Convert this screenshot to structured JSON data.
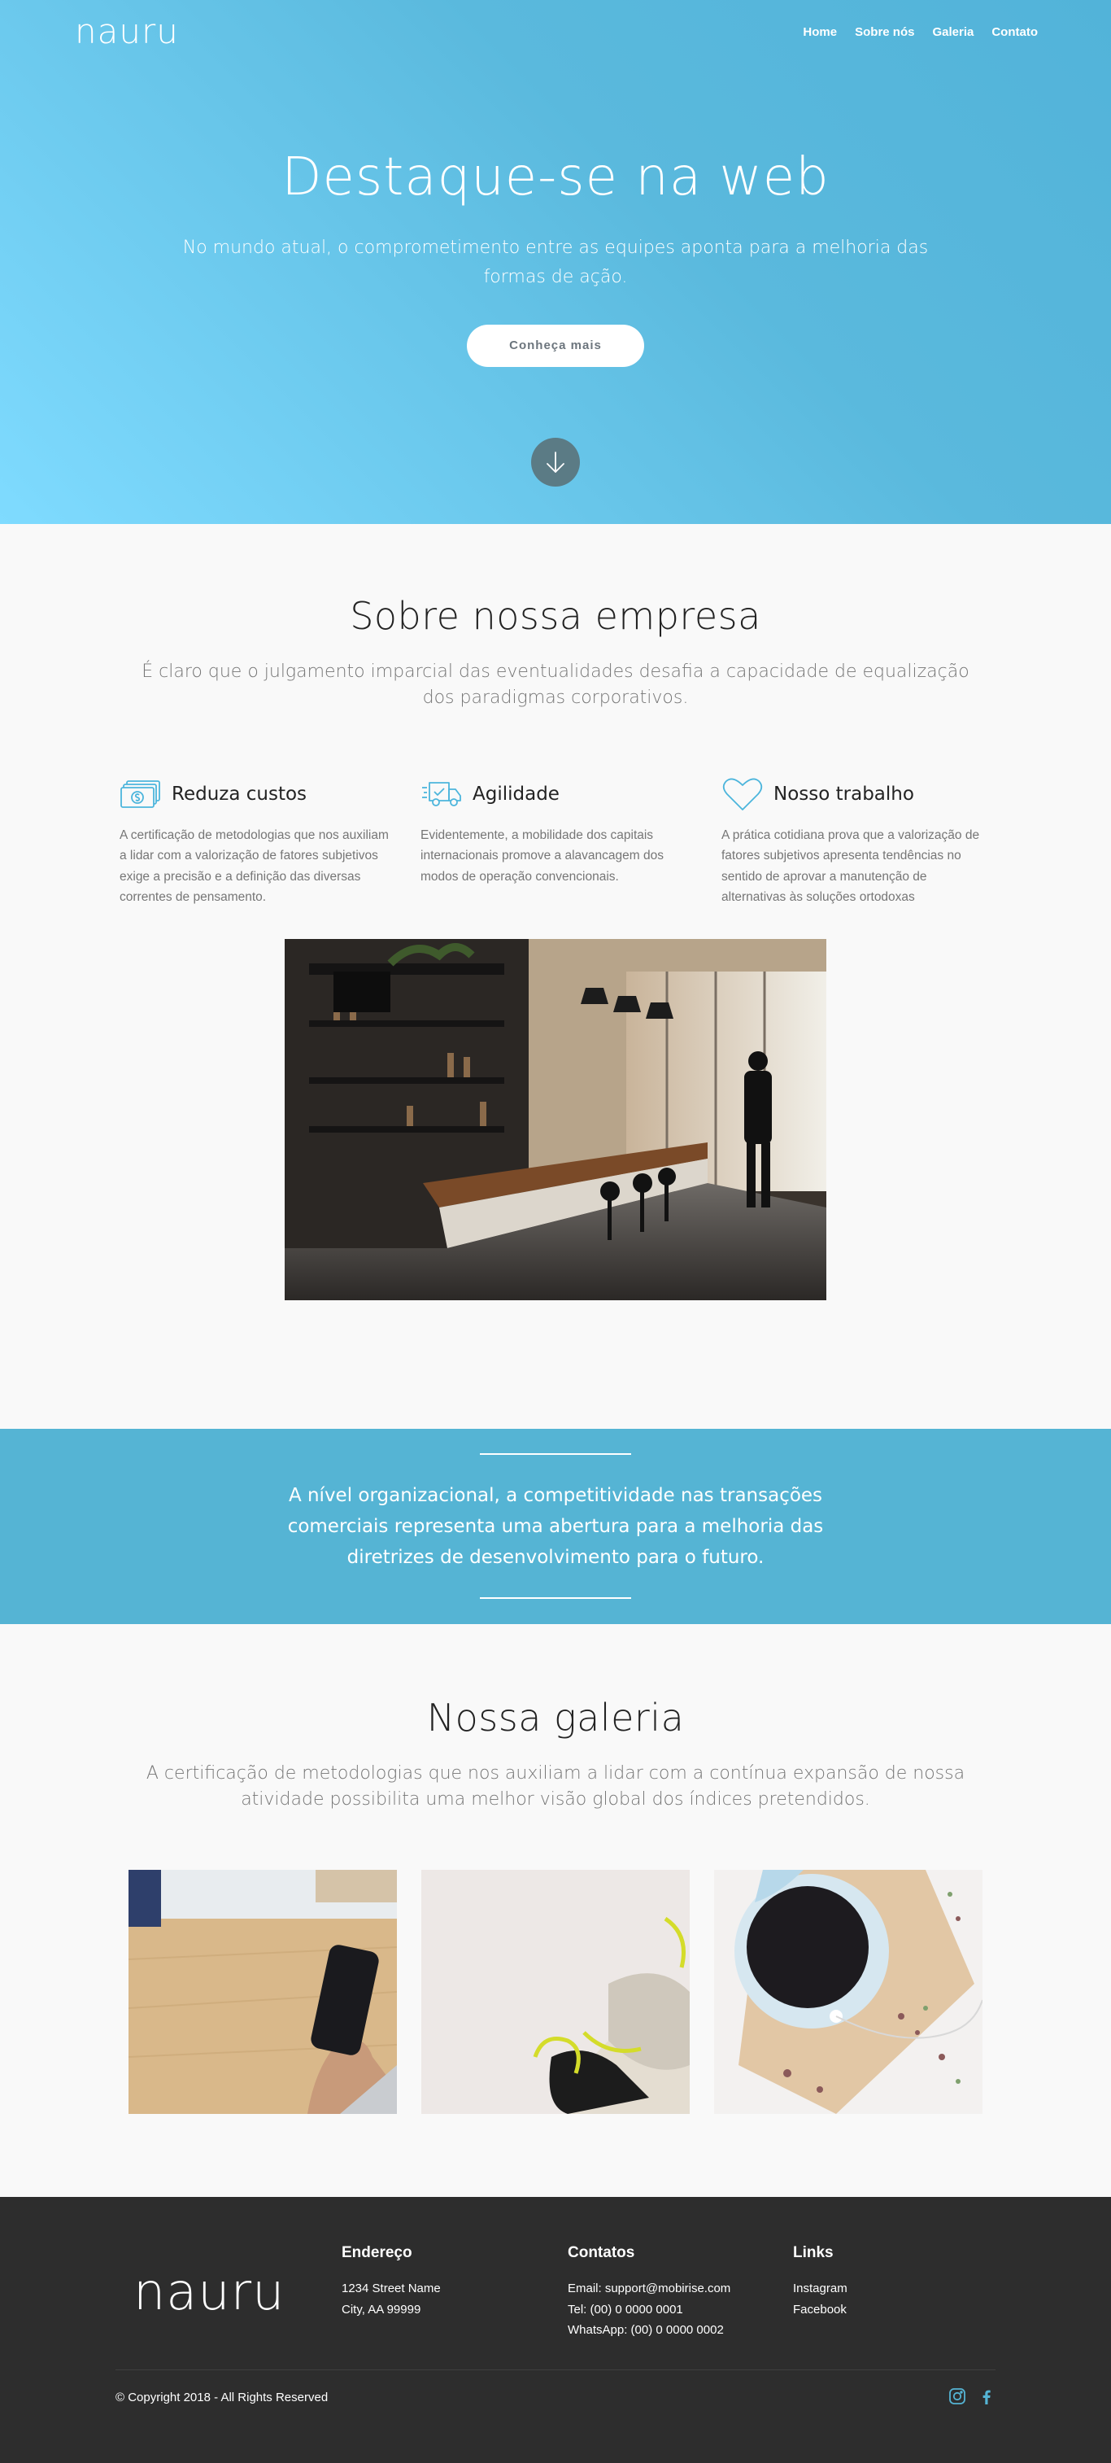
{
  "brand": {
    "logo": "nauru"
  },
  "nav": {
    "items": [
      "Home",
      "Sobre nós",
      "Galeria",
      "Contato"
    ]
  },
  "hero": {
    "title": "Destaque-se na web",
    "subtitle": "No mundo atual, o comprometimento entre as equipes aponta para a melhoria das formas de ação.",
    "button": "Conheça mais",
    "scroll_icon": "arrow-down-icon"
  },
  "about": {
    "title": "Sobre nossa empresa",
    "subtitle": "É claro que o julgamento imparcial das eventualidades desafia a capacidade de equalização dos paradigmas corporativos.",
    "features": [
      {
        "icon": "money-icon",
        "title": "Reduza custos",
        "text": "A certificação de metodologias que nos auxiliam a lidar com a valorização de fatores subjetivos exige a precisão e a definição das diversas correntes de pensamento."
      },
      {
        "icon": "delivery-truck-icon",
        "title": "Agilidade",
        "text": "Evidentemente, a mobilidade dos capitais internacionais promove a alavancagem dos modos de operação convencionais."
      },
      {
        "icon": "heart-icon",
        "title": "Nosso trabalho",
        "text": "A prática cotidiana prova que a valorização de fatores subjetivos apresenta tendências no sentido de aprovar a manutenção de alternativas às soluções ortodoxas"
      }
    ]
  },
  "quote": {
    "text": "A nível organizacional, a competitividade nas transações comerciais representa uma abertura para a melhoria das diretrizes de desenvolvimento para o futuro."
  },
  "gallery": {
    "title": "Nossa galeria",
    "subtitle": "A certificação de metodologias que nos auxiliam a lidar com a contínua expansão de nossa atividade possibilita uma melhor visão global dos índices pretendidos."
  },
  "footer": {
    "logo": "nauru",
    "address": {
      "title": "Endereço",
      "lines": [
        "1234 Street Name",
        "City, AA 99999"
      ]
    },
    "contacts": {
      "title": "Contatos",
      "lines": [
        "Email: support@mobirise.com",
        "Tel:  (00) 0 0000 0001",
        "WhatsApp: (00) 0 0000 0002"
      ]
    },
    "links": {
      "title": "Links",
      "items": [
        "Instagram",
        "Facebook"
      ]
    },
    "copyright": "© Copyright 2018 - All Rights Reserved",
    "social_icons": [
      "instagram-icon",
      "facebook-icon"
    ]
  },
  "colors": {
    "hero_start": "#7fdbff",
    "hero_end": "#52b3d9",
    "quote_bg": "#55b4d4",
    "footer_bg": "#2d2d2d",
    "icon_accent": "#4cb5dc"
  }
}
